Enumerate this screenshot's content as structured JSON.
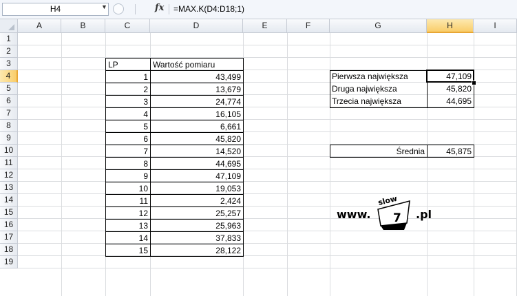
{
  "formula_bar": {
    "name_box": "H4",
    "fx_label": "fx",
    "formula": "=MAX.K(D4:D18;1)"
  },
  "columns": [
    "A",
    "B",
    "C",
    "D",
    "E",
    "F",
    "G",
    "H",
    "I"
  ],
  "rows": [
    "1",
    "2",
    "3",
    "4",
    "5",
    "6",
    "7",
    "8",
    "9",
    "10",
    "11",
    "12",
    "13",
    "14",
    "15",
    "16",
    "17",
    "18",
    "19"
  ],
  "selected": {
    "column": "H",
    "row": "4"
  },
  "table": {
    "header_lp": "LP",
    "header_value": "Wartość pomiaru",
    "rows": [
      {
        "lp": "1",
        "value": "43,499"
      },
      {
        "lp": "2",
        "value": "13,679"
      },
      {
        "lp": "3",
        "value": "24,774"
      },
      {
        "lp": "4",
        "value": "16,105"
      },
      {
        "lp": "5",
        "value": "6,661"
      },
      {
        "lp": "6",
        "value": "45,820"
      },
      {
        "lp": "7",
        "value": "14,520"
      },
      {
        "lp": "8",
        "value": "44,695"
      },
      {
        "lp": "9",
        "value": "47,109"
      },
      {
        "lp": "10",
        "value": "19,053"
      },
      {
        "lp": "11",
        "value": "2,424"
      },
      {
        "lp": "12",
        "value": "25,257"
      },
      {
        "lp": "13",
        "value": "25,963"
      },
      {
        "lp": "14",
        "value": "37,833"
      },
      {
        "lp": "15",
        "value": "28,122"
      }
    ]
  },
  "summary": {
    "first_label": "Pierwsza największa",
    "first_value": "47,109",
    "second_label": "Druga największa",
    "second_value": "45,820",
    "third_label": "Trzecia największa",
    "third_value": "44,695",
    "avg_label": "Średnia",
    "avg_value": "45,875"
  },
  "logo": {
    "www": "www.",
    "slow": "slow",
    "seven": "7",
    "pl": ".pl"
  }
}
